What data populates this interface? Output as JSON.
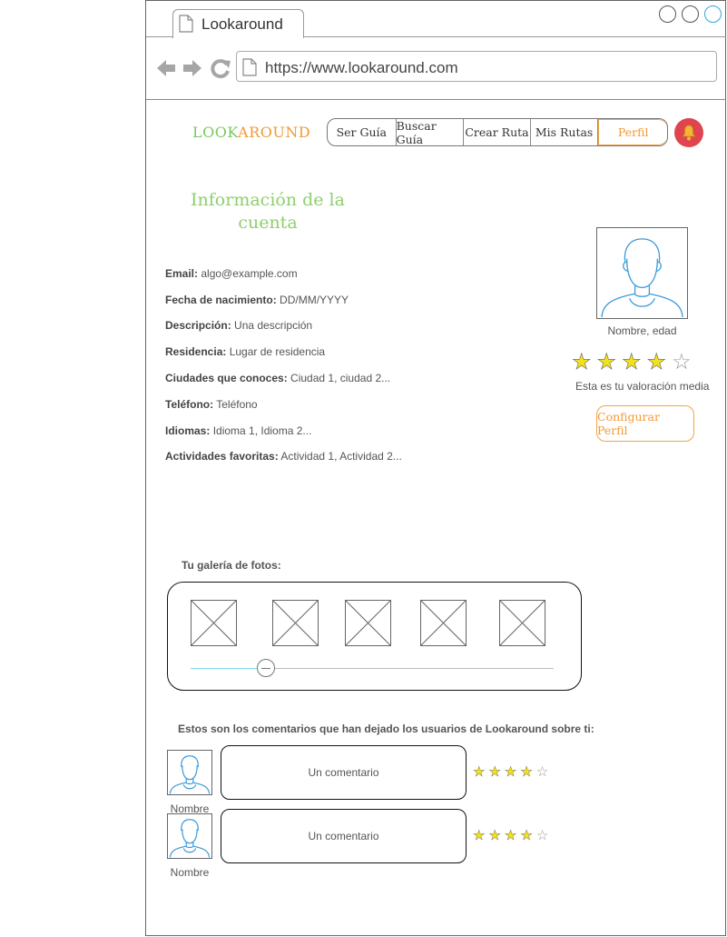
{
  "browser": {
    "tab_title": "Lookaround",
    "url": "https://www.lookaround.com"
  },
  "header": {
    "logo_part1": "LOOK",
    "logo_part2": "AROUND",
    "nav": [
      "Ser Guía",
      "Buscar Guía",
      "Crear Ruta",
      "Mis Rutas",
      "Perfil"
    ],
    "active_nav": "Perfil",
    "bell_icon": "bell-icon"
  },
  "account": {
    "title": "Información de la cuenta",
    "fields": [
      {
        "label": "Email:",
        "value": "algo@example.com"
      },
      {
        "label": "Fecha de nacimiento:",
        "value": "DD/MM/YYYY"
      },
      {
        "label": "Descripción:",
        "value": "Una descripción"
      },
      {
        "label": "Residencia:",
        "value": "Lugar de residencia"
      },
      {
        "label": "Ciudades que conoces:",
        "value": "Ciudad 1, ciudad 2..."
      },
      {
        "label": "Teléfono:",
        "value": "Teléfono"
      },
      {
        "label": "Idiomas:",
        "value": "Idioma 1, Idioma 2..."
      },
      {
        "label": "Actividades favoritas:",
        "value": "Actividad 1, Actividad 2..."
      }
    ]
  },
  "profile": {
    "name_age": "Nombre, edad",
    "rating": 4,
    "rating_max": 5,
    "rating_label": "Esta es tu valoración media",
    "config_button": "Configurar Perfil"
  },
  "gallery": {
    "label": "Tu galería de fotos:",
    "photo_count": 5,
    "slider_value": 0.21
  },
  "comments": {
    "heading": "Estos son los comentarios que han dejado los usuarios de Lookaround sobre ti:",
    "items": [
      {
        "name": "Nombre",
        "text": "Un comentario",
        "rating": 4
      },
      {
        "name": "Nombre",
        "text": "Un comentario",
        "rating": 4
      }
    ]
  },
  "colors": {
    "logo_green": "#7cc860",
    "logo_orange": "#f29a35",
    "title_green": "#8ecf6e",
    "bell_red": "#e0444e",
    "star_yellow": "#f2e11b",
    "avatar_blue": "#3a9ad9"
  }
}
